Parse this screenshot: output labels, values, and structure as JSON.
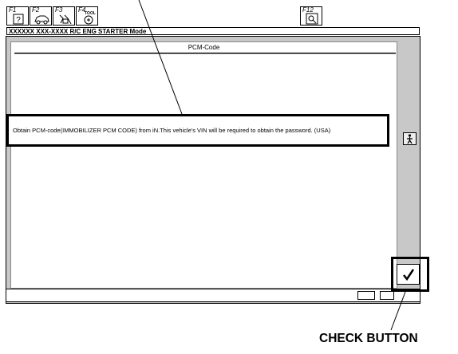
{
  "toolbar": {
    "keys": [
      {
        "label": "F1",
        "icon": "help-icon"
      },
      {
        "label": "F2",
        "icon": "vehicle-icon"
      },
      {
        "label": "F3",
        "icon": "diagnosis-icon"
      },
      {
        "label": "F4",
        "icon": "tool-icon",
        "sublabel": "TOOL"
      },
      {
        "label": "F12",
        "icon": "zoom-icon"
      }
    ]
  },
  "window": {
    "title": "XXXXXX XXX-XXXX  R/C ENG STARTER Mode"
  },
  "panel": {
    "title": "PCM-Code",
    "message": "Obtain PCM-code(IMMOBILIZER PCM CODE) from iN.This vehicle's VIN will be required to obtain the password. (USA)"
  },
  "side_button": {
    "icon": "person-icon"
  },
  "check_button": {
    "icon": "checkmark-icon"
  },
  "annotation": {
    "callout": "CHECK BUTTON"
  }
}
